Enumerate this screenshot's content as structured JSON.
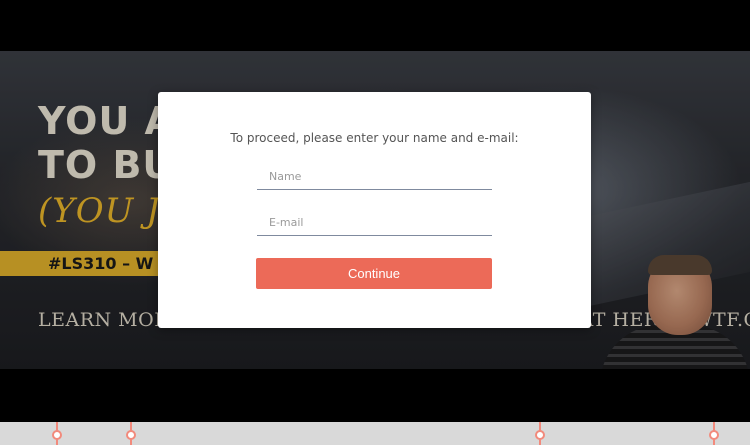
{
  "video": {
    "headline_line1": "YOU A",
    "headline_line2": "TO BU",
    "script_text": "(YOU JUS",
    "episode_tag": "#LS310 – W",
    "subtitle": "LEARN MORE AND DOWNLOAD WORKSHOP FILES AT HERE - WTF.GURU"
  },
  "modal": {
    "prompt": "To proceed, please enter your name and e-mail:",
    "name_placeholder": "Name",
    "email_placeholder": "E-mail",
    "continue_label": "Continue"
  },
  "colors": {
    "accent": "#ec6a58",
    "band": "#e0b02b",
    "timeline_marker": "#f28a7c"
  }
}
